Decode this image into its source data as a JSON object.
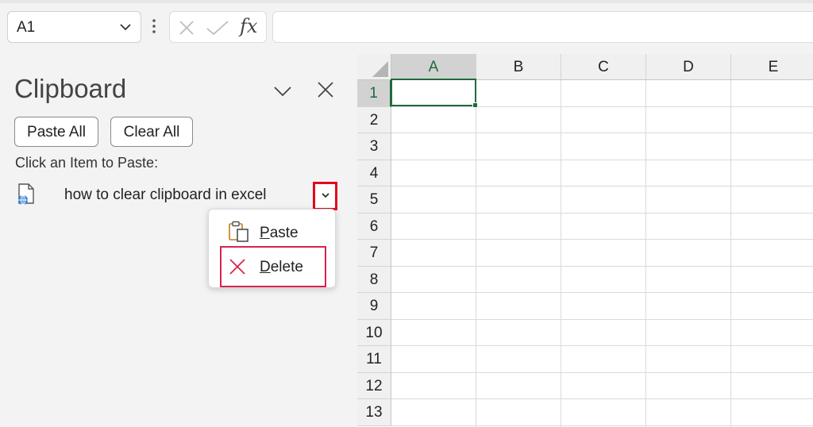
{
  "formula_bar": {
    "name_box": "A1",
    "fx_label": "fx",
    "formula_value": ""
  },
  "clipboard_pane": {
    "title": "Clipboard",
    "paste_all_label": "Paste All",
    "clear_all_label": "Clear All",
    "prompt": "Click an Item to Paste:",
    "items": [
      {
        "text": "how to clear clipboard in excel",
        "icon": "web-document-icon"
      }
    ]
  },
  "context_menu": {
    "paste": {
      "accel": "P",
      "rest": "aste",
      "icon": "paste-icon"
    },
    "delete": {
      "accel": "D",
      "rest": "elete",
      "icon": "delete-x-icon"
    }
  },
  "sheet": {
    "columns": [
      "A",
      "B",
      "C",
      "D",
      "E"
    ],
    "rows": [
      "1",
      "2",
      "3",
      "4",
      "5",
      "6",
      "7",
      "8",
      "9",
      "10",
      "11",
      "12",
      "13"
    ],
    "selected_cell": "A1"
  },
  "colors": {
    "accent_green": "#1e6b3a",
    "highlight_red": "#e10a1c",
    "delete_red": "#d9224c"
  }
}
